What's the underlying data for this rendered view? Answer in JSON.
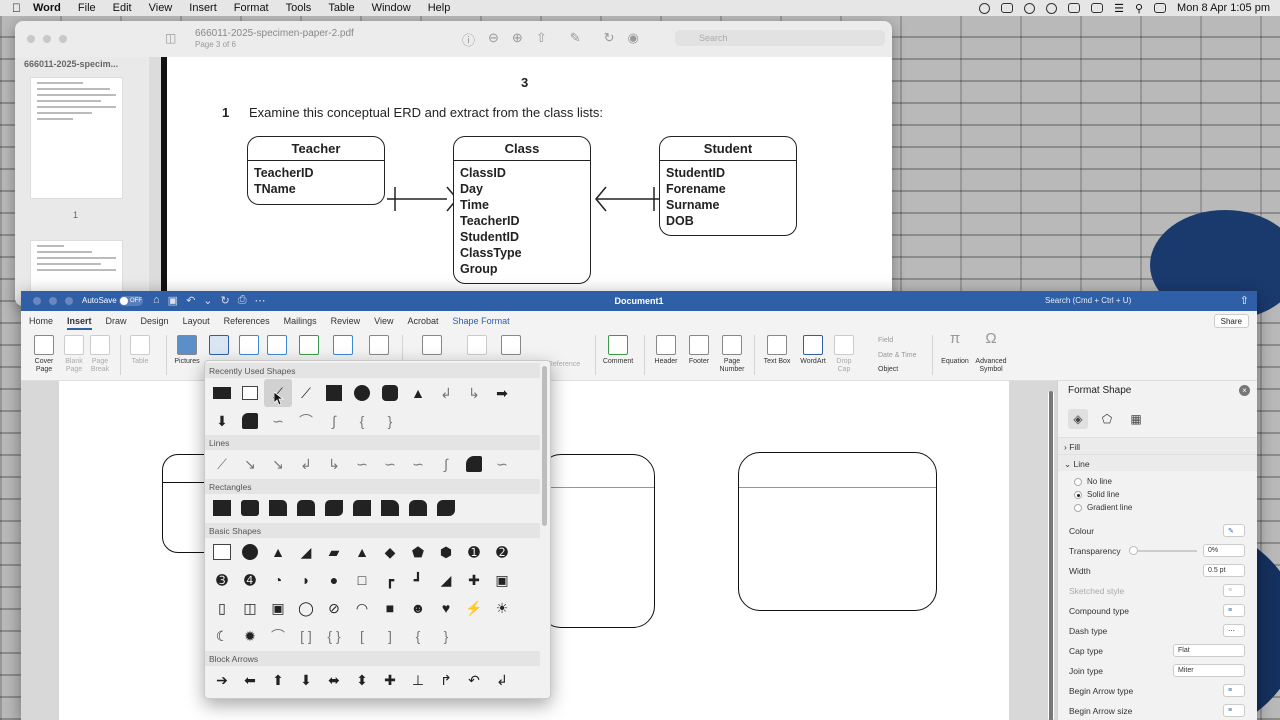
{
  "menubar": {
    "app": "Word",
    "items": [
      "File",
      "Edit",
      "View",
      "Insert",
      "Format",
      "Tools",
      "Table",
      "Window",
      "Help"
    ],
    "datetime": "Mon 8 Apr  1:05 pm"
  },
  "pdf": {
    "filename": "666011-2025-specimen-paper-2.pdf",
    "page_info": "Page 3 of 6",
    "sidebar_title": "666011-2025-specim...",
    "thumb_page_num": "1",
    "search_placeholder": "Search",
    "page_number": "3",
    "question_number": "1",
    "question_text": "Examine this conceptual ERD and extract from the class lists:",
    "entities": [
      {
        "name": "Teacher",
        "attributes": [
          "TeacherID",
          "TName"
        ]
      },
      {
        "name": "Class",
        "attributes": [
          "ClassID",
          "Day",
          "Time",
          "TeacherID",
          "StudentID",
          "ClassType",
          "Group"
        ]
      },
      {
        "name": "Student",
        "attributes": [
          "StudentID",
          "Forename",
          "Surname",
          "DOB"
        ]
      }
    ]
  },
  "word": {
    "autosave": "AutoSave",
    "autosave_state": "OFF",
    "document_title": "Document1",
    "search_placeholder": "Search (Cmd + Ctrl + U)",
    "share": "Share",
    "tabs": [
      "Home",
      "Insert",
      "Draw",
      "Design",
      "Layout",
      "References",
      "Mailings",
      "Review",
      "View",
      "Acrobat",
      "Shape Format"
    ],
    "active_tab": "Insert",
    "ribbon": {
      "cover_page": "Cover\nPage",
      "blank_page": "Blank\nPage",
      "page_break": "Page\nBreak",
      "table": "Table",
      "pictures": "Pictures",
      "cross_reference": "Reference",
      "comment": "Comment",
      "header": "Header",
      "footer": "Footer",
      "page_number": "Page\nNumber",
      "text_box": "Text Box",
      "wordart": "WordArt",
      "drop_cap": "Drop\nCap",
      "field": "Field",
      "date_time": "Date & Time",
      "object": "Object",
      "equation": "Equation",
      "advanced_symbol": "Advanced\nSymbol"
    }
  },
  "shapes_menu": {
    "categories": [
      "Recently Used Shapes",
      "Lines",
      "Rectangles",
      "Basic Shapes",
      "Block Arrows"
    ]
  },
  "format_shape": {
    "title": "Format Shape",
    "sections": {
      "fill": "Fill",
      "line": "Line"
    },
    "line_options": [
      "No line",
      "Solid line",
      "Gradient line"
    ],
    "selected_line_option": "Solid line",
    "colour": "Colour",
    "transparency": "Transparency",
    "transparency_value": "0%",
    "width": "Width",
    "width_value": "0.5 pt",
    "sketched_style": "Sketched style",
    "compound_type": "Compound type",
    "dash_type": "Dash type",
    "cap_type": "Cap type",
    "cap_type_value": "Flat",
    "join_type": "Join type",
    "join_type_value": "Miter",
    "begin_arrow_type": "Begin Arrow type",
    "begin_arrow_size": "Begin Arrow size"
  },
  "colors": {
    "word_blue": "#2e5fa7",
    "wave_blue": "#1a3a6e"
  }
}
